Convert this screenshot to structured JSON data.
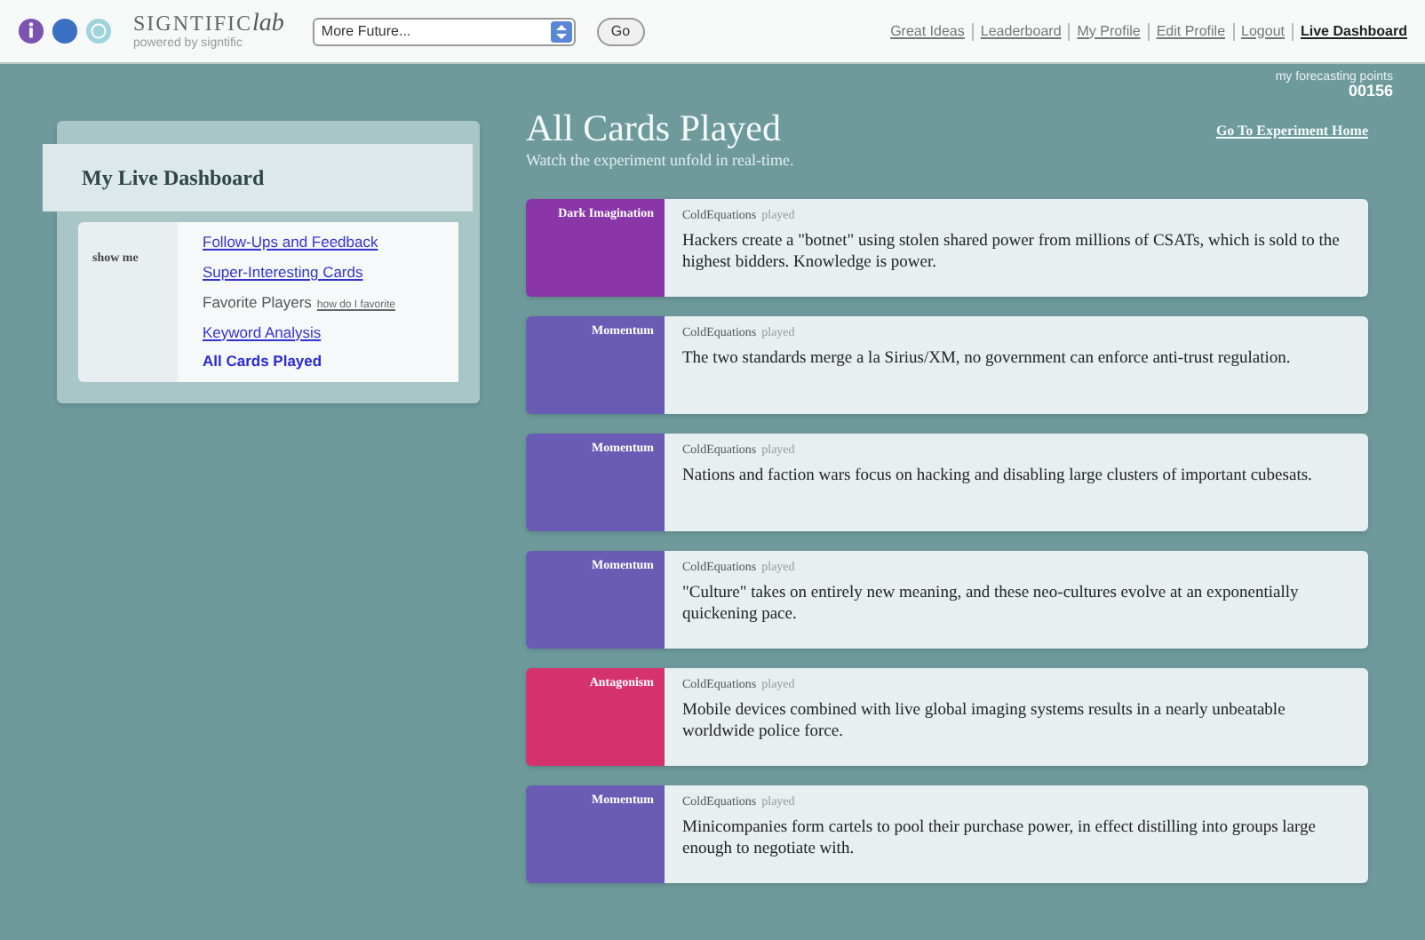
{
  "header": {
    "logo": {
      "main": "SIGNTIFIC",
      "accent": "lab",
      "tagline": "powered by signtific"
    },
    "future_select": {
      "value": "More Future..."
    },
    "go_button": "Go",
    "nav": [
      {
        "label": "Great Ideas",
        "selected": false
      },
      {
        "label": "Leaderboard",
        "selected": false
      },
      {
        "label": "My Profile",
        "selected": false
      },
      {
        "label": "Edit Profile",
        "selected": false
      },
      {
        "label": "Logout",
        "selected": false
      },
      {
        "label": "Live Dashboard",
        "selected": true
      }
    ]
  },
  "points": {
    "label": "my forecasting points",
    "value": "00156"
  },
  "sidebar": {
    "title": "My Live Dashboard",
    "show_me": "show me",
    "items": [
      {
        "label": "Follow-Ups and Feedback",
        "selected": false
      },
      {
        "label": "Super-Interesting Cards",
        "selected": false
      },
      {
        "label": "Favorite Players",
        "selected": false,
        "note": "how do I favorite"
      },
      {
        "label": "Keyword Analysis",
        "selected": false
      },
      {
        "label": "All Cards Played",
        "selected": true
      }
    ]
  },
  "main": {
    "title": "All Cards Played",
    "subtitle": "Watch the experiment unfold in real-time.",
    "home_link": "Go To Experiment Home",
    "cards": [
      {
        "tag": "Dark Imagination",
        "color": "#8a35a8",
        "player": "ColdEquations",
        "action": "played",
        "text": "Hackers create a \"botnet\" using stolen shared power from millions of CSATs, which is sold to the highest bidders. Knowledge is power."
      },
      {
        "tag": "Momentum",
        "color": "#6a5bb5",
        "player": "ColdEquations",
        "action": "played",
        "text": "The two standards merge a la Sirius/XM, no government can enforce anti-trust regulation."
      },
      {
        "tag": "Momentum",
        "color": "#6a5bb5",
        "player": "ColdEquations",
        "action": "played",
        "text": "Nations and faction wars focus on hacking and disabling large clusters of important cubesats."
      },
      {
        "tag": "Momentum",
        "color": "#6a5bb5",
        "player": "ColdEquations",
        "action": "played",
        "text": "\"Culture\" takes on entirely new meaning, and these neo-cultures evolve at an exponentially quickening pace."
      },
      {
        "tag": "Antagonism",
        "color": "#d6336e",
        "player": "ColdEquations",
        "action": "played",
        "text": "Mobile devices combined with live global imaging systems results in a nearly unbeatable worldwide police force."
      },
      {
        "tag": "Momentum",
        "color": "#6a5bb5",
        "player": "ColdEquations",
        "action": "played",
        "text": "Minicompanies form cartels to pool their purchase power, in effect distilling into groups large enough to negotiate with."
      }
    ]
  }
}
